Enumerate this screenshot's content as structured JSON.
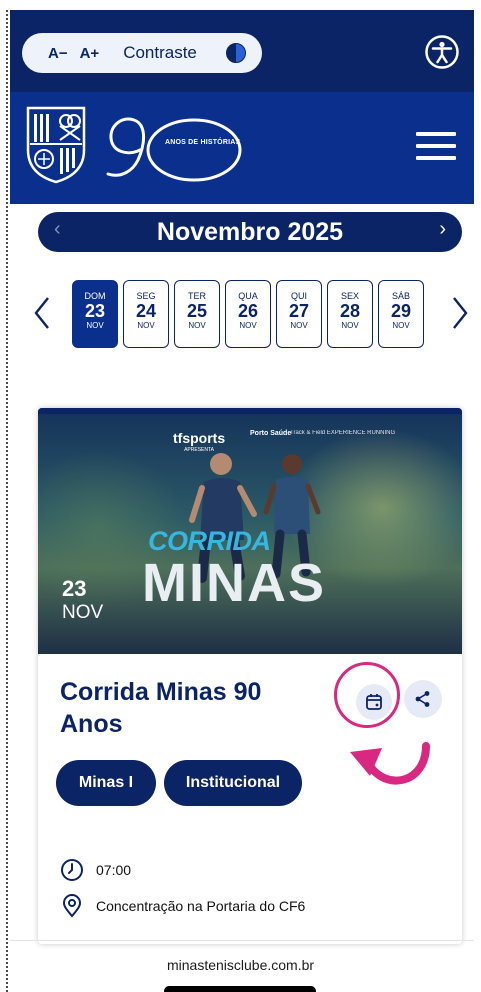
{
  "a11y": {
    "decrease_font": "A−",
    "increase_font": "A+",
    "contrast_label": "Contraste"
  },
  "brand": {
    "anniversary_tagline": "ANOS DE HISTÓRIAS",
    "colors": {
      "navy": "#0b2465",
      "royal": "#0a2f8c",
      "accent_pink": "#d8287f"
    }
  },
  "calendar": {
    "month_label": "Novembro 2025",
    "prev_month": "‹",
    "next_month": "›",
    "days": [
      {
        "weekday": "DOM",
        "day": "23",
        "month": "NOV",
        "active": true
      },
      {
        "weekday": "SEG",
        "day": "24",
        "month": "NOV",
        "active": false
      },
      {
        "weekday": "TER",
        "day": "25",
        "month": "NOV",
        "active": false
      },
      {
        "weekday": "QUA",
        "day": "26",
        "month": "NOV",
        "active": false
      },
      {
        "weekday": "QUI",
        "day": "27",
        "month": "NOV",
        "active": false
      },
      {
        "weekday": "SEX",
        "day": "28",
        "month": "NOV",
        "active": false
      },
      {
        "weekday": "SÁB",
        "day": "29",
        "month": "NOV",
        "active": false
      }
    ]
  },
  "event": {
    "banner": {
      "sponsor_tf": "tfsports",
      "sponsor_tf_sub": "APRESENTA",
      "sponsor_porto": "Porto Saúde",
      "sponsor_track": "Track & Field EXPERIENCE RUNNING",
      "corrida": "CORRIDA",
      "minas": "MINAS",
      "day": "23",
      "month": "NOV"
    },
    "title": "Corrida Minas 90 Anos",
    "tags": [
      "Minas I",
      "Institucional"
    ],
    "time": "07:00",
    "location": "Concentração na Portaria do CF6",
    "icons": {
      "calendar": "calendar-add-icon",
      "share": "share-icon",
      "clock": "clock-icon",
      "location": "location-pin-icon"
    }
  },
  "footer": {
    "url": "minastenisclube.com.br"
  }
}
